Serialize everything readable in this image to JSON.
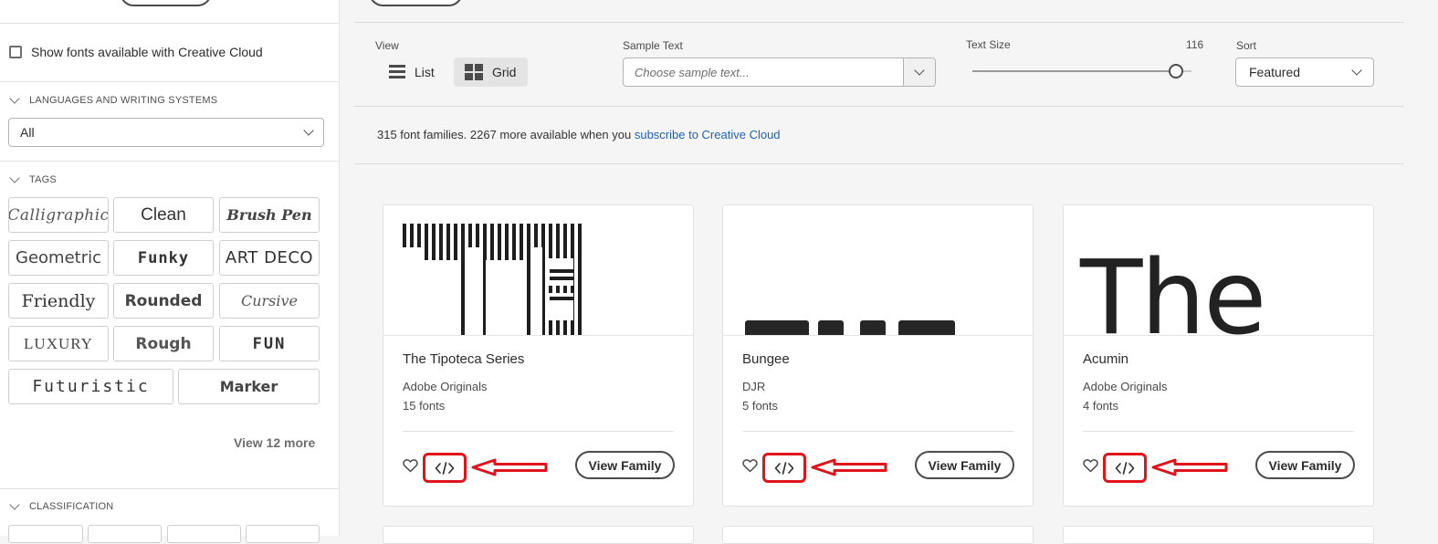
{
  "sidebar": {
    "cc_checkbox_label": "Show fonts available with Creative Cloud",
    "languages_heading": "LANGUAGES AND WRITING SYSTEMS",
    "language_selected": "All",
    "tags_heading": "TAGS",
    "tags": [
      "Calligraphic",
      "Clean",
      "Brush Pen",
      "Geometric",
      "Funky",
      "ART DECO",
      "Friendly",
      "Rounded",
      "Cursive",
      "LUXURY",
      "Rough",
      "FUN",
      "Futuristic",
      "Marker"
    ],
    "view_more": "View 12 more",
    "classification_heading": "CLASSIFICATION"
  },
  "toolbar": {
    "view_label": "View",
    "list_label": "List",
    "grid_label": "Grid",
    "sample_text_label": "Sample Text",
    "sample_text_placeholder": "Choose sample text...",
    "text_size_label": "Text Size",
    "text_size_value": "116",
    "text_size_fraction": 0.93,
    "sort_label": "Sort",
    "sort_value": "Featured"
  },
  "results": {
    "count_text": "315 font families. 2267 more available when you ",
    "subscribe_link": "subscribe to Creative Cloud"
  },
  "cards": [
    {
      "name": "The Tipoteca Series",
      "foundry": "Adobe Originals",
      "count": "15 fonts",
      "view_family": "View Family"
    },
    {
      "name": "Bungee",
      "foundry": "DJR",
      "count": "5 fonts",
      "view_family": "View Family"
    },
    {
      "name": "Acumin",
      "foundry": "Adobe Originals",
      "count": "4 fonts",
      "view_family": "View Family",
      "preview_text": "The"
    }
  ],
  "colors": {
    "annotation_red": "#e0141c",
    "link_blue": "#1f62b3"
  }
}
